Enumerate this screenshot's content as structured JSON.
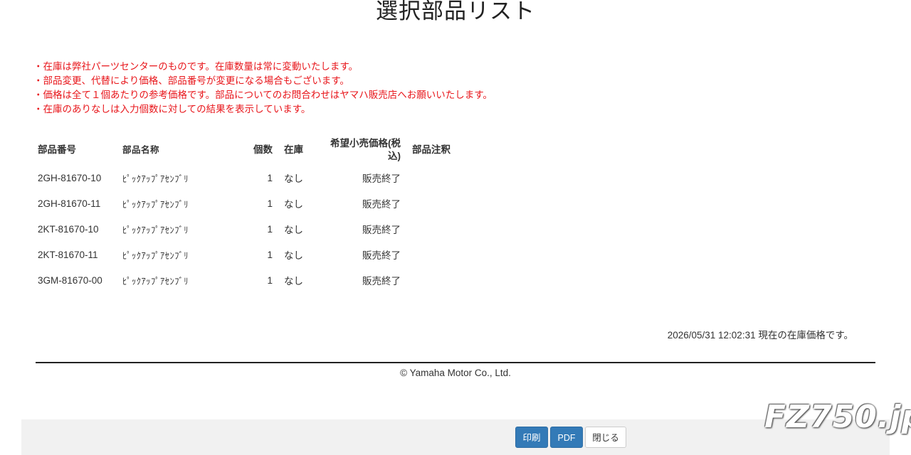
{
  "page": {
    "title": "選択部品リスト"
  },
  "notes": [
    "在庫は弊社パーツセンターのものです。在庫数量は常に変動いたします。",
    "部品変更、代替により価格、部品番号が変更になる場合もございます。",
    "価格は全て１個あたりの参考価格です。部品についてのお問合わせはヤマハ販売店へお願いいたします。",
    "在庫のありなしは入力個数に対しての結果を表示しています。"
  ],
  "table": {
    "headers": {
      "part_number": "部品番号",
      "part_name": "部品名称",
      "quantity": "個数",
      "stock": "在庫",
      "price": "希望小売価格(税込)",
      "note": "部品注釈"
    },
    "rows": [
      {
        "part_number": "2GH-81670-10",
        "part_name": "ﾋﾟｯｸｱｯﾌﾟｱｾﾝﾌﾞﾘ",
        "quantity": "1",
        "stock": "なし",
        "price": "販売終了",
        "note": ""
      },
      {
        "part_number": "2GH-81670-11",
        "part_name": "ﾋﾟｯｸｱｯﾌﾟｱｾﾝﾌﾞﾘ",
        "quantity": "1",
        "stock": "なし",
        "price": "販売終了",
        "note": ""
      },
      {
        "part_number": "2KT-81670-10",
        "part_name": "ﾋﾟｯｸｱｯﾌﾟｱｾﾝﾌﾞﾘ",
        "quantity": "1",
        "stock": "なし",
        "price": "販売終了",
        "note": ""
      },
      {
        "part_number": "2KT-81670-11",
        "part_name": "ﾋﾟｯｸｱｯﾌﾟｱｾﾝﾌﾞﾘ",
        "quantity": "1",
        "stock": "なし",
        "price": "販売終了",
        "note": ""
      },
      {
        "part_number": "3GM-81670-00",
        "part_name": "ﾋﾟｯｸｱｯﾌﾟｱｾﾝﾌﾞﾘ",
        "quantity": "1",
        "stock": "なし",
        "price": "販売終了",
        "note": ""
      }
    ]
  },
  "timestamp": "2026/05/31 12:02:31 現在の在庫価格です。",
  "copyright": "© Yamaha Motor Co., Ltd.",
  "buttons": {
    "print": "印刷",
    "pdf": "PDF",
    "close": "閉じる"
  },
  "watermark": "FZ750.jp",
  "colors": {
    "notes": "#e8161b",
    "primary_button": "#337ab7",
    "footer_bg": "#f1f1f1"
  }
}
